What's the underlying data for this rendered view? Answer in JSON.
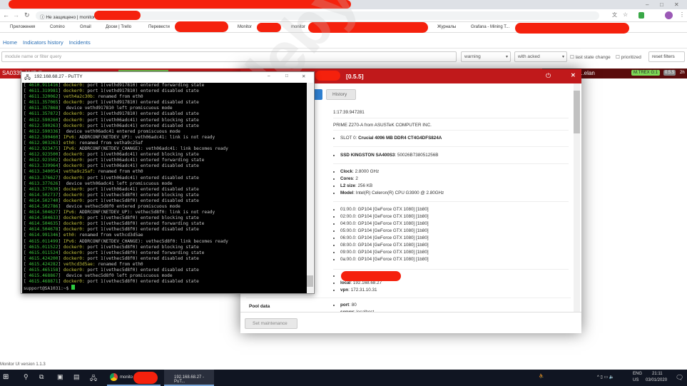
{
  "browser": {
    "security_label": "Не защищено",
    "url_prefix": "monitor",
    "bookmarks": [
      "Приложения",
      "Comino",
      "Gmail",
      "Доски | Trello",
      "Перевести",
      "Monitor",
      "monitor",
      "Журналы",
      "Grafana - Mining T..."
    ]
  },
  "app": {
    "nav": [
      "Home",
      "Indicators history",
      "Incidents"
    ],
    "filter_placeholder": "module name or filter query",
    "severity": "warning",
    "ack": "with acked",
    "last_state_change": "last state change",
    "prioritized": "prioritized",
    "reset": "reset filters",
    "row1_name": "SA0339-AMD@...",
    "row_right_name": "...elan",
    "row_right_badge": "M.TREX G:1",
    "row_right_version": "0.5.5",
    "row_right_extra": "2h",
    "version_text": "Monitor UI version 1.1.3"
  },
  "putty": {
    "title": "192.168.68.27 - PuTTY",
    "lines": [
      [
        "4610.911416",
        "docker0:",
        " port 1(vethd917810) entered forwarding state"
      ],
      [
        "4611.319981",
        "docker0:",
        " port 1(vethd917810) entered disabled state"
      ],
      [
        "4611.320062",
        "veth4a2c30b:",
        " renamed from eth0"
      ],
      [
        "4611.357065",
        "docker0:",
        " port 1(vethd917810) entered disabled state"
      ],
      [
        "4611.357868",
        "",
        " device vethd917810 left promiscuous mode"
      ],
      [
        "4611.357872",
        "docker0:",
        " port 1(vethd917810) entered disabled state"
      ],
      [
        "4612.590260",
        "docker0:",
        " port 1(veth06adc41) entered blocking state"
      ],
      [
        "4612.590263",
        "docker0:",
        " port 1(veth06adc41) entered disabled state"
      ],
      [
        "4612.590336",
        "",
        " device veth06adc41 entered promiscuous mode"
      ],
      [
        "4612.590460",
        "IPv6:",
        " ADDRCONF(NETDEV_UP): veth06adc41: link is not ready"
      ],
      [
        "4612.903263",
        "eth0:",
        " renamed from vetha9c25af"
      ],
      [
        "4612.923475",
        "IPv6:",
        " ADDRCONF(NETDEV_CHANGE): veth06adc41: link becomes ready"
      ],
      [
        "4612.923500",
        "docker0:",
        " port 1(veth06adc41) entered blocking state"
      ],
      [
        "4612.923502",
        "docker0:",
        " port 1(veth06adc41) entered forwarding state"
      ],
      [
        "4613.339964",
        "docker0:",
        " port 1(veth06adc41) entered disabled state"
      ],
      [
        "4613.340054",
        "vetha9c25af:",
        " renamed from eth0"
      ],
      [
        "4613.376627",
        "docker0:",
        " port 1(veth06adc41) entered disabled state"
      ],
      [
        "4613.377626",
        "",
        " device veth06adc41 left promiscuous mode"
      ],
      [
        "4613.377630",
        "docker0:",
        " port 1(veth06adc41) entered disabled state"
      ],
      [
        "4614.502737",
        "docker0:",
        " port 1(vethec5d8f0) entered blocking state"
      ],
      [
        "4614.502740",
        "docker0:",
        " port 1(vethec5d8f0) entered disabled state"
      ],
      [
        "4614.502786",
        "",
        " device vethec5d8f0 entered promiscuous mode"
      ],
      [
        "4614.504627",
        "IPv6:",
        " ADDRCONF(NETDEV_UP): vethec5d8f0: link is not ready"
      ],
      [
        "4614.504633",
        "docker0:",
        " port 1(vethec5d8f0) entered blocking state"
      ],
      [
        "4614.504635",
        "docker0:",
        " port 1(vethec5d8f0) entered forwarding state"
      ],
      [
        "4614.504678",
        "docker0:",
        " port 1(vethec5d8f0) entered disabled state"
      ],
      [
        "4614.991346",
        "eth0:",
        " renamed from vethcd3d5ae"
      ],
      [
        "4615.011499",
        "IPv6:",
        " ADDRCONF(NETDEV_CHANGE): vethec5d8f0: link becomes ready"
      ],
      [
        "4615.011522",
        "docker0:",
        " port 1(vethec5d8f0) entered blocking state"
      ],
      [
        "4615.011524",
        "docker0:",
        " port 1(vethec5d8f0) entered forwarding state"
      ],
      [
        "4615.424200",
        "docker0:",
        " port 1(vethec5d8f0) entered disabled state"
      ],
      [
        "4615.424282",
        "vethcd3d5ae:",
        " renamed from eth0"
      ],
      [
        "4615.465158",
        "docker0:",
        " port 1(vethec5d8f0) entered disabled state"
      ],
      [
        "4615.468867",
        "",
        " device vethec5d8f0 left promiscuous mode"
      ],
      [
        "4615.468871",
        "docker0:",
        " port 1(vethec5d8f0) entered disabled state"
      ]
    ],
    "prompt": "support@SA1031:~$ "
  },
  "modal": {
    "version": "[0.5.5]",
    "tab_history": "History",
    "uptime": "1:17:39.947281",
    "motherboard": "PRIME Z270-A from ASUSTeK COMPUTER INC.",
    "ram": {
      "slot": "SLOT 0: ",
      "value": "Crucial 4096 MB DDR4 CT4G4DFS824A"
    },
    "disk": {
      "name": "SSD KINGSTON SA400S3",
      "serial": ": 50026B738051256B"
    },
    "cpu": [
      [
        "Clock",
        ": 2.8000 GHz"
      ],
      [
        "Cores",
        ": 2"
      ],
      [
        "L2 size",
        ": 256 KB"
      ],
      [
        "Model",
        ": Intel(R) Celeron(R) CPU G3900 @ 2.80GHz"
      ]
    ],
    "gpus": [
      "01:00.0: GP104 [GeForce GTX 1080] [1b80]",
      "02:00.0: GP104 [GeForce GTX 1080] [1b80]",
      "04:00.0: GP104 [GeForce GTX 1080] [1b80]",
      "05:00.0: GP104 [GeForce GTX 1080] [1b80]",
      "06:00.0: GP104 [GeForce GTX 1080] [1b80]",
      "08:00.0: GP104 [GeForce GTX 1080] [1b80]",
      "09:00.0: GP104 [GeForce GTX 1080] [1b80]",
      "0a:00.0: GP104 [GeForce GTX 1080] [1b80]"
    ],
    "ips": [
      [
        "local",
        ": 192.168.68.27"
      ],
      [
        "vpn",
        ": 172.31.10.31"
      ]
    ],
    "pool_label": "Pool data",
    "pool": [
      [
        "port",
        ": 80"
      ],
      [
        "server",
        ": localhost"
      ]
    ],
    "maintenance": "Set maintenance"
  },
  "taskbar": {
    "chrome_label": "monito",
    "putty_label": "192.168.68.27 - PuT...",
    "lang": "ENG",
    "region": "US",
    "time": "21:11",
    "date": "03/01/2020"
  },
  "watermark": "Codeby.net"
}
